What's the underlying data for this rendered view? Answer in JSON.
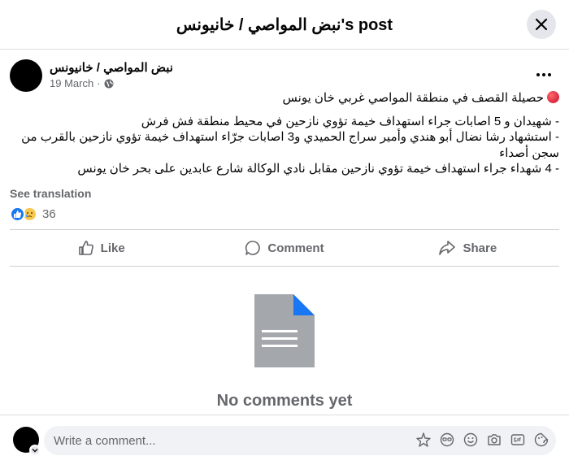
{
  "header": {
    "title": "نبض المواصي / خانيونس's post"
  },
  "post": {
    "author": "نبض المواصي / خانيونس",
    "date": "19 March",
    "date_sep": "·",
    "headline": "حصيلة القصف في منطقة المواصي غربي خان يونس",
    "lines": [
      "- شهيدان و 5 اصابات جراء استهداف خيمة تؤوي نازحين في محيط منطقة فش فرش",
      "- استشهاد رشا نضال أبو هندي وأمير سراج الحميدي و3 اصابات جرّاء استهداف خيمة تؤوي نازحين بالقرب من سجن أصداء",
      "- 4 شهداء جراء استهداف خيمة تؤوي نازحين مقابل نادي الوكالة شارع عابدين على بحر خان يونس"
    ],
    "see_translation": "See translation",
    "reaction_count": "36"
  },
  "actions": {
    "like": "Like",
    "comment": "Comment",
    "share": "Share"
  },
  "comments": {
    "empty_text": "No comments yet"
  },
  "composer": {
    "placeholder": "Write a comment..."
  },
  "colors": {
    "accent": "#1877f2",
    "secondary_text": "#65676b",
    "surface": "#f0f2f5"
  },
  "icons": [
    "close-icon",
    "more-icon",
    "globe-icon",
    "like-icon",
    "comment-icon",
    "share-icon",
    "document-icon",
    "chevron-down-icon",
    "avatar-sticker-icon",
    "sticker-icon",
    "emoji-icon",
    "camera-icon",
    "gif-icon",
    "sticker-face-icon"
  ]
}
